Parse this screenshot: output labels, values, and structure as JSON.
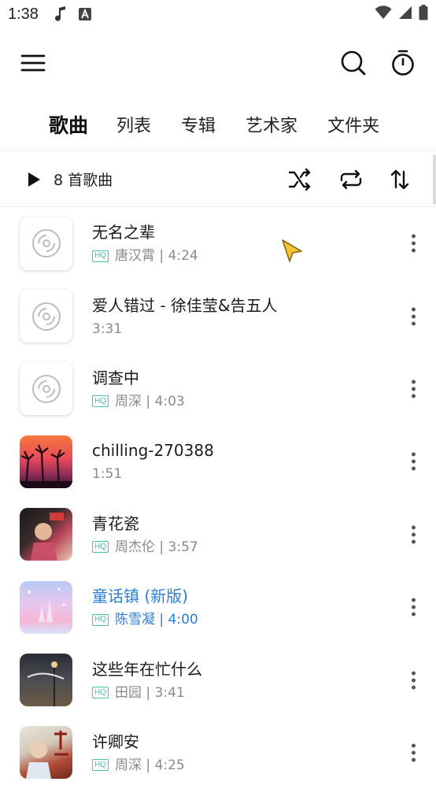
{
  "status_bar": {
    "time": "1:38"
  },
  "tabs": [
    {
      "label": "歌曲",
      "active": true
    },
    {
      "label": "列表",
      "active": false
    },
    {
      "label": "专辑",
      "active": false
    },
    {
      "label": "艺术家",
      "active": false
    },
    {
      "label": "文件夹",
      "active": false
    }
  ],
  "toolbar": {
    "count_label": "8 首歌曲"
  },
  "hq_badge": "HQ",
  "songs": [
    {
      "title": "无名之辈",
      "meta": "唐汉霄 | 4:24",
      "hq": true,
      "cover": "placeholder",
      "playing": false
    },
    {
      "title": "爱人错过 - 徐佳莹&告五人",
      "meta": "3:31",
      "hq": false,
      "cover": "placeholder",
      "playing": false
    },
    {
      "title": "调查中",
      "meta": "周深 | 4:03",
      "hq": true,
      "cover": "placeholder",
      "playing": false
    },
    {
      "title": "chilling-270388",
      "meta": "1:51",
      "hq": false,
      "cover": "sunset",
      "playing": false
    },
    {
      "title": "青花瓷",
      "meta": "周杰伦 | 3:57",
      "hq": true,
      "cover": "jay",
      "playing": false
    },
    {
      "title": "童话镇 (新版)",
      "meta": "陈雪凝 | 4:00",
      "hq": true,
      "cover": "fairy",
      "playing": true
    },
    {
      "title": "这些年在忙什么",
      "meta": "田园 | 3:41",
      "hq": true,
      "cover": "night",
      "playing": false
    },
    {
      "title": "许卿安",
      "meta": "周深 | 4:25",
      "hq": true,
      "cover": "xu",
      "playing": false
    }
  ],
  "colors": {
    "accent": "#2d7ed8",
    "hq_badge": "#45c5a5",
    "text_secondary": "#8a8a8a"
  }
}
